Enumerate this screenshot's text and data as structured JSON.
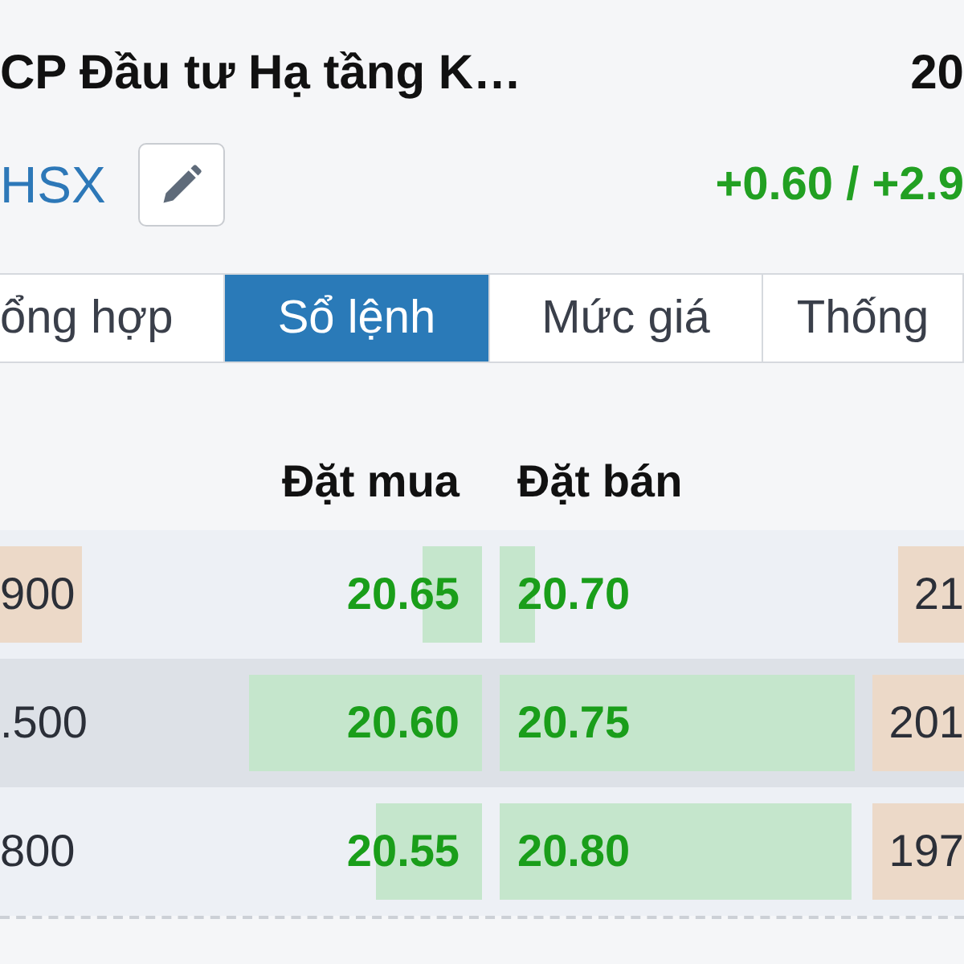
{
  "header": {
    "name": "CP Đầu tư Hạ tầng K…",
    "price": "20",
    "exchange": "HSX",
    "change": "+0.60 / +2.9"
  },
  "tabs": [
    {
      "label": "ổng hợp",
      "selected": false
    },
    {
      "label": "Sổ lệnh",
      "selected": true
    },
    {
      "label": "Mức giá",
      "selected": false
    },
    {
      "label": "Thống",
      "selected": false
    }
  ],
  "columns": {
    "bid": "Đặt mua",
    "ask": "Đặt bán"
  },
  "rows": [
    {
      "highlighted": false,
      "bid_volume": "900",
      "bid_volume_flash": true,
      "bid_price": "20.65",
      "ask_price": "20.70",
      "ask_volume": "21"
    },
    {
      "highlighted": true,
      "bid_volume": ".500",
      "bid_volume_flash": false,
      "bid_price": "20.60",
      "ask_price": "20.75",
      "ask_volume": "201"
    },
    {
      "highlighted": false,
      "bid_volume": "800",
      "bid_volume_flash": false,
      "bid_price": "20.55",
      "ask_price": "20.80",
      "ask_volume": "197"
    }
  ]
}
